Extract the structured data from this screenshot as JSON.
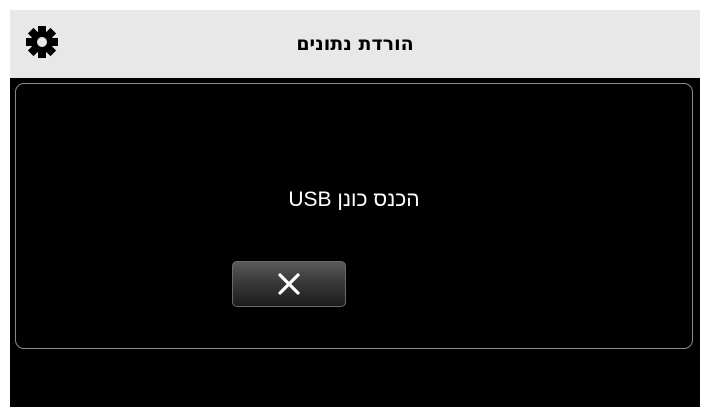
{
  "header": {
    "title": "הורדת נתונים",
    "settings_icon": "gear-icon"
  },
  "dialog": {
    "message": "הכנס כונן USB",
    "close_icon": "close-icon"
  },
  "colors": {
    "header_bg": "#e8e8e8",
    "screen_bg": "#000000",
    "text_light": "#ffffff",
    "border": "#8a8a8a"
  }
}
